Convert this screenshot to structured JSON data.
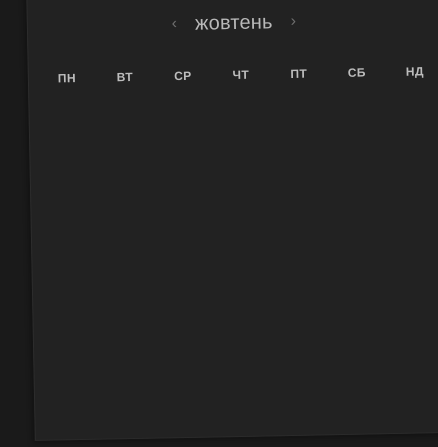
{
  "calendar": {
    "month": "жовтень",
    "prev_icon": "chevron-left-icon",
    "next_icon": "chevron-right-icon",
    "prev_glyph": "‹",
    "next_glyph": "›",
    "weekdays": [
      "ПН",
      "ВТ",
      "СР",
      "ЧТ",
      "ПТ",
      "СБ",
      "НД"
    ]
  },
  "colors": {
    "background": "#1a1a1a",
    "panel": "#222222",
    "text": "#bdbdbd",
    "arrow": "#6f6f6f"
  }
}
